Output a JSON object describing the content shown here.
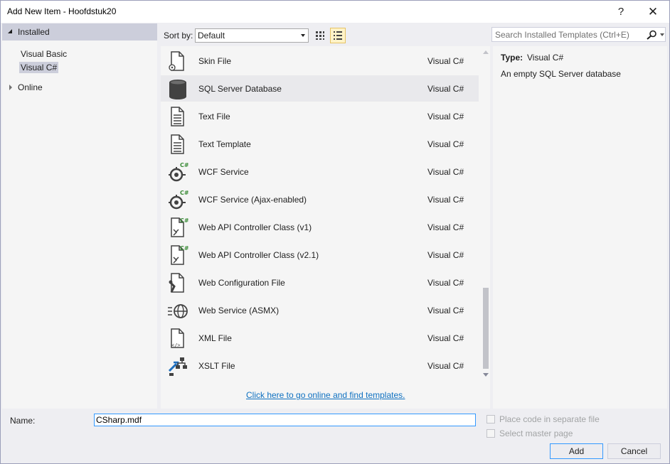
{
  "window": {
    "title": "Add New Item - Hoofdstuk20",
    "help_glyph": "?",
    "close_glyph": "✕"
  },
  "tree": {
    "installed": "Installed",
    "children": [
      "Visual Basic",
      "Visual C#"
    ],
    "selected": "Visual C#",
    "online": "Online"
  },
  "toolbar": {
    "sort_label": "Sort by:",
    "sort_value": "Default",
    "view_mode": "list"
  },
  "search": {
    "placeholder": "Search Installed Templates (Ctrl+E)"
  },
  "items": [
    {
      "name": "Skin File",
      "type": "Visual C#",
      "icon": "skin-file-icon"
    },
    {
      "name": "SQL Server Database",
      "type": "Visual C#",
      "icon": "database-icon"
    },
    {
      "name": "Text File",
      "type": "Visual C#",
      "icon": "text-file-icon"
    },
    {
      "name": "Text Template",
      "type": "Visual C#",
      "icon": "text-template-icon"
    },
    {
      "name": "WCF Service",
      "type": "Visual C#",
      "icon": "wcf-service-icon"
    },
    {
      "name": "WCF Service (Ajax-enabled)",
      "type": "Visual C#",
      "icon": "wcf-service-icon"
    },
    {
      "name": "Web API Controller Class (v1)",
      "type": "Visual C#",
      "icon": "web-api-controller-icon"
    },
    {
      "name": "Web API Controller Class (v2.1)",
      "type": "Visual C#",
      "icon": "web-api-controller-icon"
    },
    {
      "name": "Web Configuration File",
      "type": "Visual C#",
      "icon": "web-config-icon"
    },
    {
      "name": "Web Service (ASMX)",
      "type": "Visual C#",
      "icon": "web-service-globe-icon"
    },
    {
      "name": "XML File",
      "type": "Visual C#",
      "icon": "xml-file-icon"
    },
    {
      "name": "XSLT File",
      "type": "Visual C#",
      "icon": "xslt-file-icon"
    }
  ],
  "selected_item": "SQL Server Database",
  "online_link": "Click here to go online and find templates.",
  "info": {
    "type_label": "Type:",
    "type_value": "Visual C#",
    "description": "An empty SQL Server database"
  },
  "footer": {
    "name_label": "Name:",
    "name_value": "CSharp.mdf",
    "place_code_label": "Place code in separate file",
    "select_master_label": "Select master page",
    "add_label": "Add",
    "cancel_label": "Cancel"
  },
  "colors": {
    "accent": "#3399ff",
    "link": "#0e70c0",
    "csharp_badge": "#388a34"
  }
}
